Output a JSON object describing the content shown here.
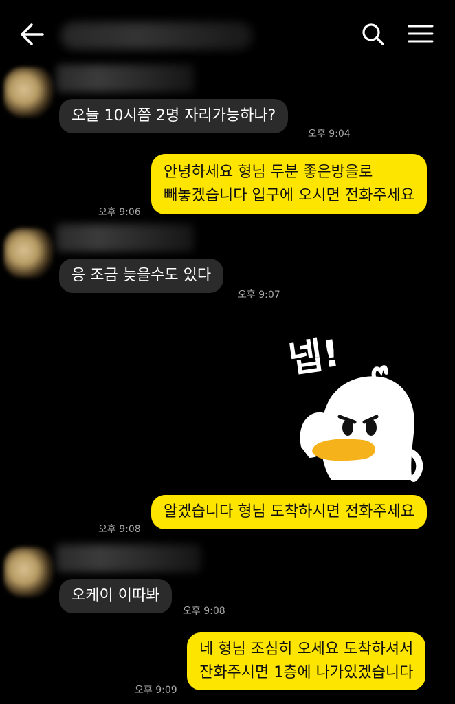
{
  "header": {
    "back_icon": "arrow-left-icon",
    "search_icon": "search-icon",
    "menu_icon": "hamburger-menu-icon"
  },
  "messages": [
    {
      "direction": "in",
      "text": "오늘 10시쯤 2명 자리가능하나?",
      "time": "오후 9:04"
    },
    {
      "direction": "out",
      "lines": [
        "안녕하세요 형님 두분 좋은방을로",
        "빼놓겠습니다 입구에 오시면 전화주세요"
      ],
      "time": "오후 9:06"
    },
    {
      "direction": "in",
      "text": "응 조금 늦을수도 있다",
      "time": "오후 9:07"
    },
    {
      "direction": "out",
      "sticker": {
        "text": "넵!",
        "icon": "duck-sticker-icon"
      }
    },
    {
      "direction": "out",
      "text": "알겠습니다 형님 도착하시면 전화주세요",
      "time": "오후 9:08"
    },
    {
      "direction": "in",
      "text": "오케이 이따봐",
      "time": "오후 9:08"
    },
    {
      "direction": "out",
      "lines": [
        "네 형님 조심히 오세요 도착하셔서",
        "잔화주시면 1층에 나가있겠습니다"
      ],
      "time": "오후 9:09"
    }
  ],
  "colors": {
    "background": "#000000",
    "incoming_bubble": "#2b2b2b",
    "outgoing_bubble": "#fee500",
    "timestamp": "#a9a9a9"
  }
}
